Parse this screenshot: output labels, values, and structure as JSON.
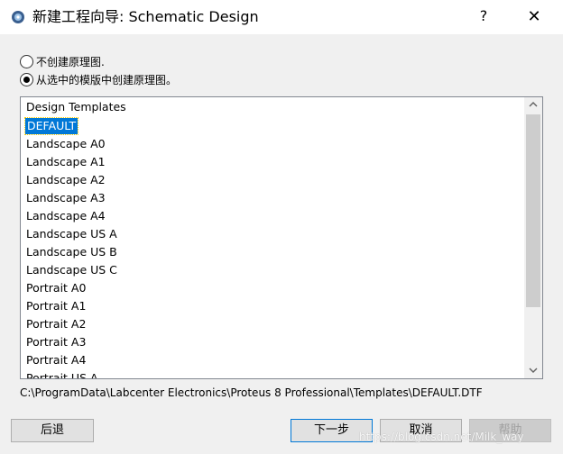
{
  "window": {
    "title": "新建工程向导: Schematic Design",
    "help_label": "?",
    "close_label": "✕",
    "icon": "proteus-app-icon"
  },
  "options": {
    "no_schematic_label": "不创建原理图.",
    "no_schematic_checked": false,
    "from_template_label": "从选中的模版中创建原理图。",
    "from_template_checked": true
  },
  "list": {
    "header": "Design Templates",
    "items": [
      "DEFAULT",
      "Landscape A0",
      "Landscape A1",
      "Landscape A2",
      "Landscape A3",
      "Landscape A4",
      "Landscape US A",
      "Landscape US B",
      "Landscape US C",
      "Portrait A0",
      "Portrait A1",
      "Portrait A2",
      "Portrait A3",
      "Portrait A4",
      "Portrait US A"
    ],
    "selected": "DEFAULT"
  },
  "path": "C:\\ProgramData\\Labcenter Electronics\\Proteus 8 Professional\\Templates\\DEFAULT.DTF",
  "buttons": {
    "back": "后退",
    "next": "下一步",
    "cancel": "取消",
    "help": "帮助"
  },
  "watermark": "https://blog.csdn.net/Milk_way"
}
